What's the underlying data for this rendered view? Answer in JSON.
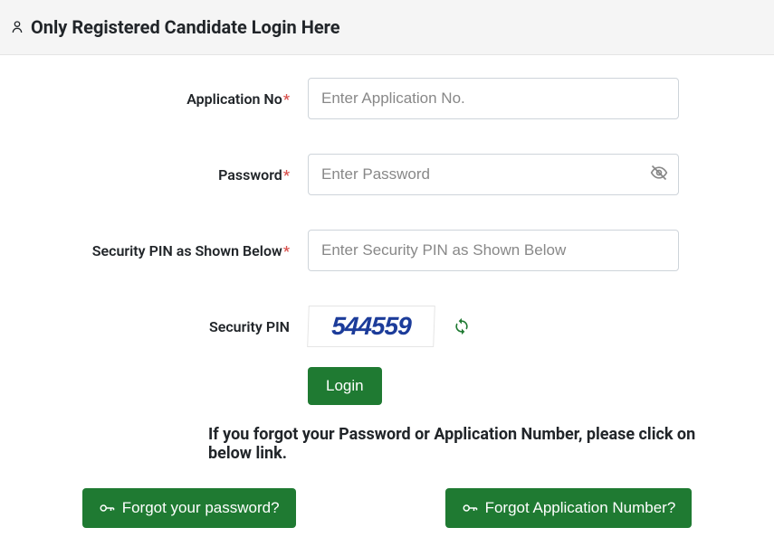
{
  "header": {
    "title": "Only Registered Candidate Login Here"
  },
  "form": {
    "appno_label": "Application No",
    "appno_placeholder": "Enter Application No.",
    "password_label": "Password",
    "password_placeholder": "Enter Password",
    "pin_input_label": "Security PIN as Shown Below",
    "pin_input_placeholder": "Enter Security PIN as Shown Below",
    "pin_display_label": "Security PIN",
    "captcha_value": "544559",
    "login_button": "Login"
  },
  "forgot": {
    "message": "If you forgot your Password or Application Number, please click on below link.",
    "password_button": "Forgot your password?",
    "appno_button": "Forgot Application Number?"
  }
}
